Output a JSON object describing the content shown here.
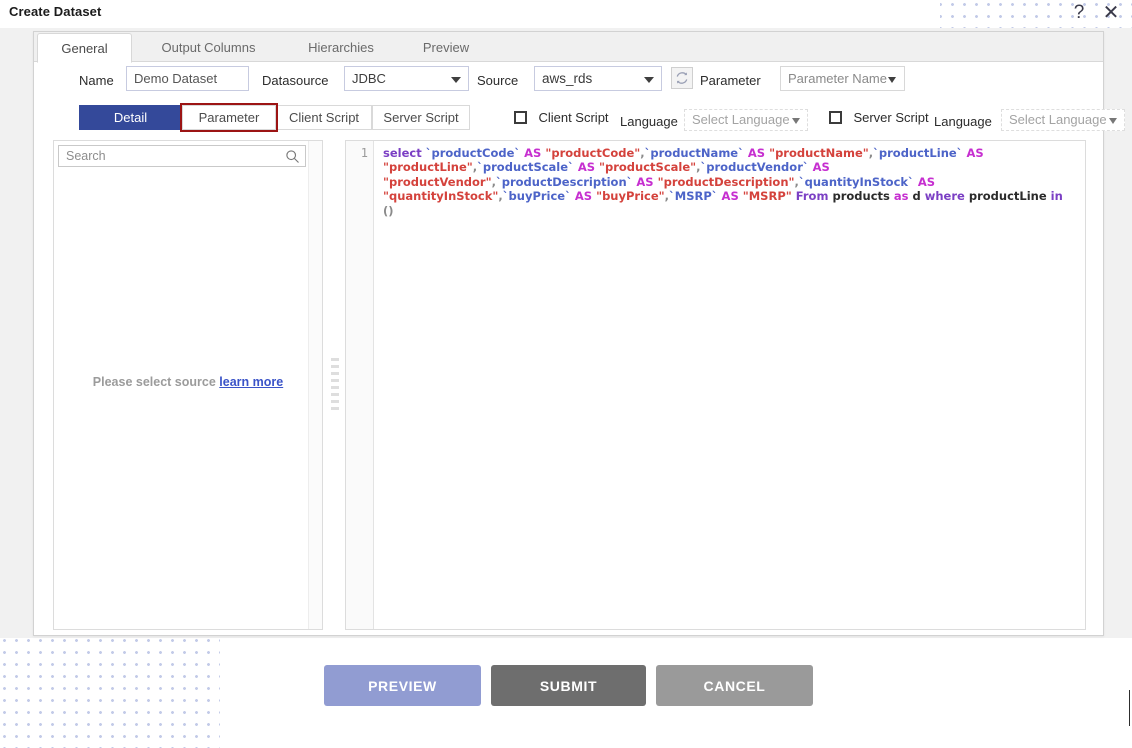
{
  "window": {
    "title": "Create Dataset",
    "help_icon": "question-mark-icon",
    "close_icon": "close-x-icon"
  },
  "tabs": [
    {
      "label": "General",
      "active": true
    },
    {
      "label": "Output Columns",
      "active": false
    },
    {
      "label": "Hierarchies",
      "active": false
    },
    {
      "label": "Preview",
      "active": false
    }
  ],
  "form": {
    "name_label": "Name",
    "name_value": "Demo Dataset",
    "name_placeholder": "Demo Dataset",
    "datasource_label": "Datasource",
    "datasource_value": "JDBC",
    "source_label": "Source",
    "source_value": "aws_rds",
    "refresh_icon": "refresh-icon",
    "parameter_label": "Parameter",
    "parameter_name_value": "Parameter Name"
  },
  "subtabs": [
    {
      "label": "Detail",
      "state": "selected"
    },
    {
      "label": "Parameter",
      "state": "highlighted"
    },
    {
      "label": "Client Script",
      "state": "normal"
    },
    {
      "label": "Server Script",
      "state": "normal"
    }
  ],
  "script_options": {
    "client_checkbox_label": "Client Script",
    "client_checked": false,
    "client_language_label": "Language",
    "client_language_value": "Select Language",
    "server_checkbox_label": "Server Script",
    "server_checked": false,
    "server_language_label": "Language",
    "server_language_value": "Select Language"
  },
  "left_panel": {
    "search_placeholder": "Search",
    "search_value": "",
    "search_icon": "search-icon",
    "empty_message": "Please select source",
    "learn_more_label": "learn more"
  },
  "editor": {
    "line_number": "1",
    "sql": "select `productCode` AS \"productCode\",`productName` AS \"productName\",`productLine` AS \"productLine\",`productScale` AS \"productScale\",`productVendor` AS \"productVendor\",`productDescription` AS \"productDescription\",`quantityInStock` AS \"quantityInStock\",`buyPrice` AS \"buyPrice\",`MSRP` AS \"MSRP\" From products as d where productLine in ()",
    "tokens": [
      {
        "t": "select",
        "c": "kw"
      },
      {
        "t": " ",
        "c": "plain"
      },
      {
        "t": "`productCode`",
        "c": "ident"
      },
      {
        "t": " ",
        "c": "plain"
      },
      {
        "t": "AS",
        "c": "as"
      },
      {
        "t": " ",
        "c": "plain"
      },
      {
        "t": "\"productCode\"",
        "c": "str"
      },
      {
        "t": ",",
        "c": "punct"
      },
      {
        "t": "`productName`",
        "c": "ident"
      },
      {
        "t": " ",
        "c": "plain"
      },
      {
        "t": "AS",
        "c": "as"
      },
      {
        "t": " ",
        "c": "plain"
      },
      {
        "t": "\"productName\"",
        "c": "str"
      },
      {
        "t": ",",
        "c": "punct"
      },
      {
        "t": "`productLine`",
        "c": "ident"
      },
      {
        "t": " ",
        "c": "plain"
      },
      {
        "t": "AS",
        "c": "as"
      },
      {
        "t": " ",
        "c": "plain"
      },
      {
        "t": "\"productLine\"",
        "c": "str"
      },
      {
        "t": ",",
        "c": "punct"
      },
      {
        "t": "`productScale`",
        "c": "ident"
      },
      {
        "t": " ",
        "c": "plain"
      },
      {
        "t": "AS",
        "c": "as"
      },
      {
        "t": " ",
        "c": "plain"
      },
      {
        "t": "\"productScale\"",
        "c": "str"
      },
      {
        "t": ",",
        "c": "punct"
      },
      {
        "t": "`productVendor`",
        "c": "ident"
      },
      {
        "t": " ",
        "c": "plain"
      },
      {
        "t": "AS",
        "c": "as"
      },
      {
        "t": " ",
        "c": "plain"
      },
      {
        "t": "\"productVendor\"",
        "c": "str"
      },
      {
        "t": ",",
        "c": "punct"
      },
      {
        "t": "`productDescription`",
        "c": "ident"
      },
      {
        "t": " ",
        "c": "plain"
      },
      {
        "t": "AS",
        "c": "as"
      },
      {
        "t": " ",
        "c": "plain"
      },
      {
        "t": "\"productDescription\"",
        "c": "str"
      },
      {
        "t": ",",
        "c": "punct"
      },
      {
        "t": "`quantityInStock`",
        "c": "ident"
      },
      {
        "t": " ",
        "c": "plain"
      },
      {
        "t": "AS",
        "c": "as"
      },
      {
        "t": " ",
        "c": "plain"
      },
      {
        "t": "\"quantityInStock\"",
        "c": "str"
      },
      {
        "t": ",",
        "c": "punct"
      },
      {
        "t": "`buyPrice`",
        "c": "ident"
      },
      {
        "t": " ",
        "c": "plain"
      },
      {
        "t": "AS",
        "c": "as"
      },
      {
        "t": " ",
        "c": "plain"
      },
      {
        "t": "\"buyPrice\"",
        "c": "str"
      },
      {
        "t": ",",
        "c": "punct"
      },
      {
        "t": "`MSRP`",
        "c": "ident"
      },
      {
        "t": " ",
        "c": "plain"
      },
      {
        "t": "AS",
        "c": "as"
      },
      {
        "t": " ",
        "c": "plain"
      },
      {
        "t": "\"MSRP\"",
        "c": "str"
      },
      {
        "t": " ",
        "c": "plain"
      },
      {
        "t": "From",
        "c": "kw"
      },
      {
        "t": " ",
        "c": "plain"
      },
      {
        "t": "products",
        "c": "plain"
      },
      {
        "t": " ",
        "c": "plain"
      },
      {
        "t": "as",
        "c": "as"
      },
      {
        "t": " ",
        "c": "plain"
      },
      {
        "t": "d",
        "c": "plain"
      },
      {
        "t": " ",
        "c": "plain"
      },
      {
        "t": "where",
        "c": "kw"
      },
      {
        "t": " ",
        "c": "plain"
      },
      {
        "t": "productLine",
        "c": "plain"
      },
      {
        "t": " ",
        "c": "plain"
      },
      {
        "t": "in",
        "c": "kw"
      },
      {
        "t": " ",
        "c": "plain"
      },
      {
        "t": "()",
        "c": "punct"
      }
    ]
  },
  "actions": {
    "preview_label": "PREVIEW",
    "submit_label": "SUBMIT",
    "cancel_label": "CANCEL"
  },
  "colors": {
    "accent_blue": "#34499a",
    "highlight_red": "#9c1414",
    "preview_button": "#919cd2",
    "submit_button": "#6e6e6e",
    "cancel_button": "#9a9a9a",
    "dot_pattern": "#c3cbe8"
  }
}
